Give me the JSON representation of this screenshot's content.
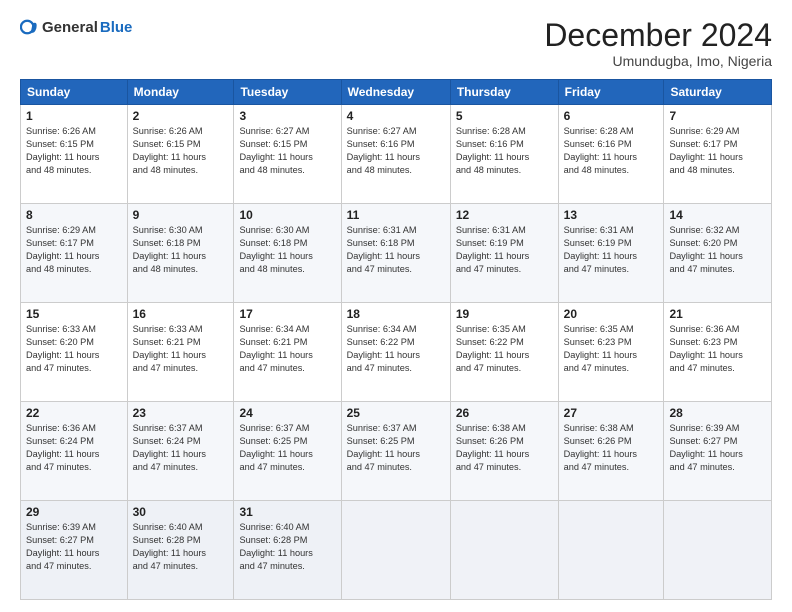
{
  "logo": {
    "general": "General",
    "blue": "Blue"
  },
  "title": "December 2024",
  "location": "Umundugba, Imo, Nigeria",
  "days_of_week": [
    "Sunday",
    "Monday",
    "Tuesday",
    "Wednesday",
    "Thursday",
    "Friday",
    "Saturday"
  ],
  "weeks": [
    [
      {
        "day": 1,
        "info": "Sunrise: 6:26 AM\nSunset: 6:15 PM\nDaylight: 11 hours\nand 48 minutes."
      },
      {
        "day": 2,
        "info": "Sunrise: 6:26 AM\nSunset: 6:15 PM\nDaylight: 11 hours\nand 48 minutes."
      },
      {
        "day": 3,
        "info": "Sunrise: 6:27 AM\nSunset: 6:15 PM\nDaylight: 11 hours\nand 48 minutes."
      },
      {
        "day": 4,
        "info": "Sunrise: 6:27 AM\nSunset: 6:16 PM\nDaylight: 11 hours\nand 48 minutes."
      },
      {
        "day": 5,
        "info": "Sunrise: 6:28 AM\nSunset: 6:16 PM\nDaylight: 11 hours\nand 48 minutes."
      },
      {
        "day": 6,
        "info": "Sunrise: 6:28 AM\nSunset: 6:16 PM\nDaylight: 11 hours\nand 48 minutes."
      },
      {
        "day": 7,
        "info": "Sunrise: 6:29 AM\nSunset: 6:17 PM\nDaylight: 11 hours\nand 48 minutes."
      }
    ],
    [
      {
        "day": 8,
        "info": "Sunrise: 6:29 AM\nSunset: 6:17 PM\nDaylight: 11 hours\nand 48 minutes."
      },
      {
        "day": 9,
        "info": "Sunrise: 6:30 AM\nSunset: 6:18 PM\nDaylight: 11 hours\nand 48 minutes."
      },
      {
        "day": 10,
        "info": "Sunrise: 6:30 AM\nSunset: 6:18 PM\nDaylight: 11 hours\nand 48 minutes."
      },
      {
        "day": 11,
        "info": "Sunrise: 6:31 AM\nSunset: 6:18 PM\nDaylight: 11 hours\nand 47 minutes."
      },
      {
        "day": 12,
        "info": "Sunrise: 6:31 AM\nSunset: 6:19 PM\nDaylight: 11 hours\nand 47 minutes."
      },
      {
        "day": 13,
        "info": "Sunrise: 6:31 AM\nSunset: 6:19 PM\nDaylight: 11 hours\nand 47 minutes."
      },
      {
        "day": 14,
        "info": "Sunrise: 6:32 AM\nSunset: 6:20 PM\nDaylight: 11 hours\nand 47 minutes."
      }
    ],
    [
      {
        "day": 15,
        "info": "Sunrise: 6:33 AM\nSunset: 6:20 PM\nDaylight: 11 hours\nand 47 minutes."
      },
      {
        "day": 16,
        "info": "Sunrise: 6:33 AM\nSunset: 6:21 PM\nDaylight: 11 hours\nand 47 minutes."
      },
      {
        "day": 17,
        "info": "Sunrise: 6:34 AM\nSunset: 6:21 PM\nDaylight: 11 hours\nand 47 minutes."
      },
      {
        "day": 18,
        "info": "Sunrise: 6:34 AM\nSunset: 6:22 PM\nDaylight: 11 hours\nand 47 minutes."
      },
      {
        "day": 19,
        "info": "Sunrise: 6:35 AM\nSunset: 6:22 PM\nDaylight: 11 hours\nand 47 minutes."
      },
      {
        "day": 20,
        "info": "Sunrise: 6:35 AM\nSunset: 6:23 PM\nDaylight: 11 hours\nand 47 minutes."
      },
      {
        "day": 21,
        "info": "Sunrise: 6:36 AM\nSunset: 6:23 PM\nDaylight: 11 hours\nand 47 minutes."
      }
    ],
    [
      {
        "day": 22,
        "info": "Sunrise: 6:36 AM\nSunset: 6:24 PM\nDaylight: 11 hours\nand 47 minutes."
      },
      {
        "day": 23,
        "info": "Sunrise: 6:37 AM\nSunset: 6:24 PM\nDaylight: 11 hours\nand 47 minutes."
      },
      {
        "day": 24,
        "info": "Sunrise: 6:37 AM\nSunset: 6:25 PM\nDaylight: 11 hours\nand 47 minutes."
      },
      {
        "day": 25,
        "info": "Sunrise: 6:37 AM\nSunset: 6:25 PM\nDaylight: 11 hours\nand 47 minutes."
      },
      {
        "day": 26,
        "info": "Sunrise: 6:38 AM\nSunset: 6:26 PM\nDaylight: 11 hours\nand 47 minutes."
      },
      {
        "day": 27,
        "info": "Sunrise: 6:38 AM\nSunset: 6:26 PM\nDaylight: 11 hours\nand 47 minutes."
      },
      {
        "day": 28,
        "info": "Sunrise: 6:39 AM\nSunset: 6:27 PM\nDaylight: 11 hours\nand 47 minutes."
      }
    ],
    [
      {
        "day": 29,
        "info": "Sunrise: 6:39 AM\nSunset: 6:27 PM\nDaylight: 11 hours\nand 47 minutes."
      },
      {
        "day": 30,
        "info": "Sunrise: 6:40 AM\nSunset: 6:28 PM\nDaylight: 11 hours\nand 47 minutes."
      },
      {
        "day": 31,
        "info": "Sunrise: 6:40 AM\nSunset: 6:28 PM\nDaylight: 11 hours\nand 47 minutes."
      },
      null,
      null,
      null,
      null
    ]
  ]
}
